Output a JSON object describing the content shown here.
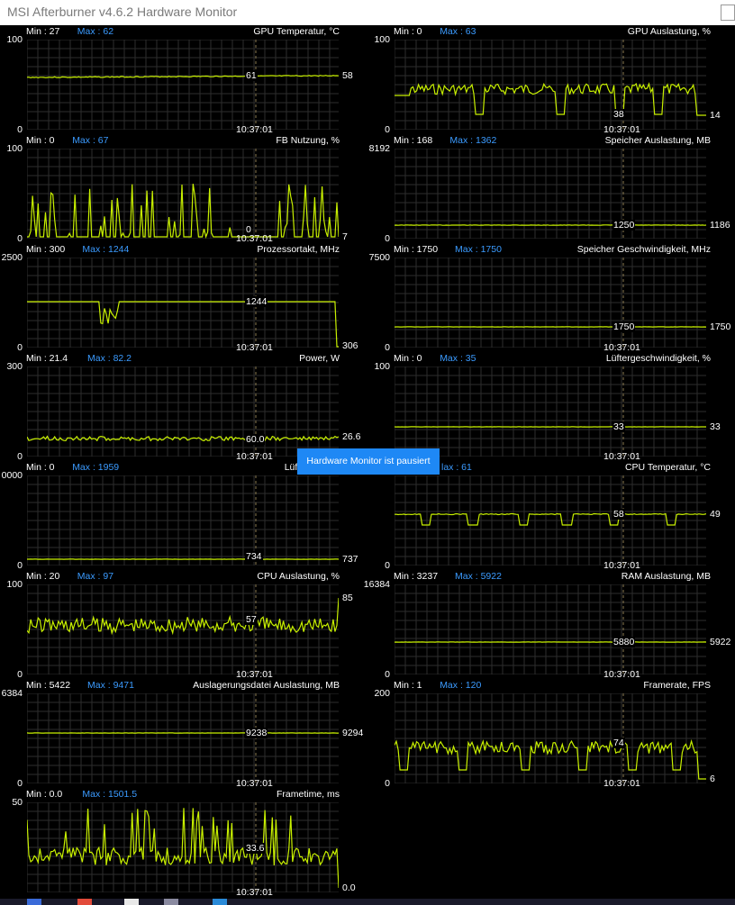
{
  "window": {
    "title": "MSI Afterburner v4.6.2 Hardware Monitor"
  },
  "tooltip": "Hardware Monitor ist pausiert",
  "colors": {
    "line": "#c8f000",
    "grid": "#2e2e2e",
    "accent": "#3b9bff",
    "tooltip_bg": "#1e88f5",
    "background": "#000000"
  },
  "panels": [
    {
      "id": "gpu-temp",
      "title": "GPU Temperatur, °C",
      "min": "Min : 27",
      "max": "Max : 62",
      "axis_top": "100",
      "axis_bottom": "0",
      "current": "58",
      "mid_value": "61",
      "time": "10:37:01"
    },
    {
      "id": "gpu-load",
      "title": "GPU Auslastung, %",
      "min": "Min : 0",
      "max": "Max : 63",
      "axis_top": "100",
      "axis_bottom": "0",
      "current": "14",
      "mid_value": "38",
      "time": "10:37:01"
    },
    {
      "id": "fb-usage",
      "title": "FB Nutzung, %",
      "min": "Min : 0",
      "max": "Max : 67",
      "axis_top": "100",
      "axis_bottom": "0",
      "current": "7",
      "mid_value": "0",
      "time": "10:37:01"
    },
    {
      "id": "mem-usage",
      "title": "Speicher Auslastung, MB",
      "min": "Min : 168",
      "max": "Max : 1362",
      "axis_top": "8192",
      "axis_bottom": "0",
      "current": "1186",
      "mid_value": "1250",
      "time": ""
    },
    {
      "id": "cpu-clock",
      "title": "Prozessortakt, MHz",
      "min": "Min : 300",
      "max": "Max : 1244",
      "axis_top": "2500",
      "axis_bottom": "0",
      "current": "306",
      "mid_value": "1244",
      "time": "10:37:01"
    },
    {
      "id": "mem-clock",
      "title": "Speicher Geschwindigkeit, MHz",
      "min": "Min : 1750",
      "max": "Max : 1750",
      "axis_top": "7500",
      "axis_bottom": "0",
      "current": "1750",
      "mid_value": "1750",
      "time": "10:37:01"
    },
    {
      "id": "power",
      "title": "Power, W",
      "min": "Min : 21.4",
      "max": "Max : 82.2",
      "axis_top": "300",
      "axis_bottom": "0",
      "current": "26.6",
      "mid_value": "60.0",
      "time": "10:37:01"
    },
    {
      "id": "fan-speed",
      "title": "Lüftergeschwindigkeit, %",
      "min": "Min : 0",
      "max": "Max : 35",
      "axis_top": "100",
      "axis_bottom": "0",
      "current": "33",
      "mid_value": "33",
      "time": "10:37:01"
    },
    {
      "id": "fan-tach",
      "title": "Lüftertachom",
      "min": "Min : 0",
      "max": "Max : 1959",
      "axis_top": "0000",
      "axis_bottom": "0",
      "current": "737",
      "mid_value": "734",
      "time": ""
    },
    {
      "id": "cpu-temp",
      "title": "CPU Temperatur, °C",
      "min": "",
      "max": "lax : 61",
      "axis_top": "",
      "axis_bottom": "0",
      "current": "49",
      "mid_value": "58",
      "time": "10:37:01"
    },
    {
      "id": "cpu-load",
      "title": "CPU Auslastung, %",
      "min": "Min : 20",
      "max": "Max : 97",
      "axis_top": "100",
      "axis_bottom": "0",
      "current": "85",
      "mid_value": "57",
      "time": "10:37:01"
    },
    {
      "id": "ram-usage",
      "title": "RAM Auslastung, MB",
      "min": "Min : 3237",
      "max": "Max : 5922",
      "axis_top": "16384",
      "axis_bottom": "0",
      "current": "5922",
      "mid_value": "5880",
      "time": "10:37:01"
    },
    {
      "id": "pagefile",
      "title": "Auslagerungsdatei Auslastung, MB",
      "min": "Min : 5422",
      "max": "Max : 9471",
      "axis_top": "6384",
      "axis_bottom": "0",
      "current": "9294",
      "mid_value": "9238",
      "time": "10:37:01"
    },
    {
      "id": "framerate",
      "title": "Framerate, FPS",
      "min": "Min : 1",
      "max": "Max : 120",
      "axis_top": "200",
      "axis_bottom": "0",
      "current": "6",
      "mid_value": "74",
      "time": "10:37:01"
    },
    {
      "id": "frametime",
      "title": "Frametime, ms",
      "min": "Min : 0.0",
      "max": "Max : 1501.5",
      "axis_top": "50",
      "axis_bottom": "",
      "current": "0.0",
      "mid_value": "33.6",
      "time": "10:37:01"
    }
  ]
}
